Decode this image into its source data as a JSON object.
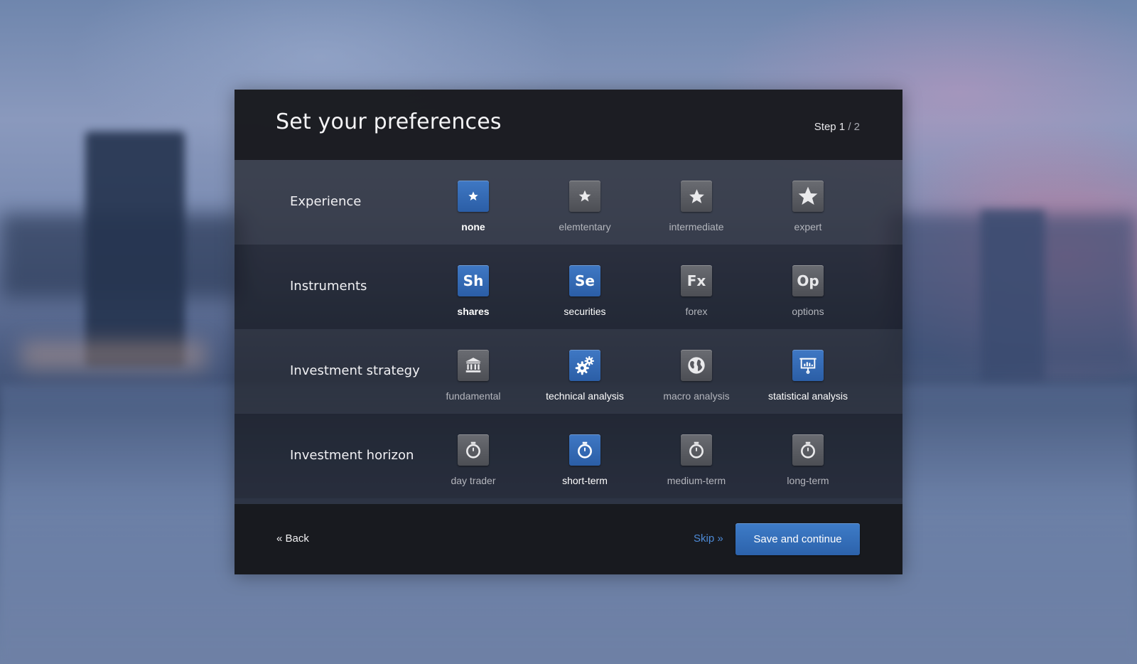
{
  "header": {
    "title": "Set your preferences",
    "step_label": "Step",
    "step_current": "1",
    "step_total": "/ 2"
  },
  "rows": [
    {
      "label": "Experience",
      "options": [
        {
          "label": "none",
          "icon": "star-small-icon",
          "selected": true
        },
        {
          "label": "elemtentary",
          "icon": "star-medium-icon",
          "selected": false
        },
        {
          "label": "intermediate",
          "icon": "star-large-icon",
          "selected": false
        },
        {
          "label": "expert",
          "icon": "star-xlarge-icon",
          "selected": false
        }
      ]
    },
    {
      "label": "Instruments",
      "options": [
        {
          "label": "shares",
          "icon_text": "Sh",
          "selected": true
        },
        {
          "label": "securities",
          "icon_text": "Se",
          "selected": true
        },
        {
          "label": "forex",
          "icon_text": "Fx",
          "selected": false
        },
        {
          "label": "options",
          "icon_text": "Op",
          "selected": false
        }
      ]
    },
    {
      "label": "Investment strategy",
      "options": [
        {
          "label": "fundamental",
          "icon": "bank-icon",
          "selected": false
        },
        {
          "label": "technical analysis",
          "icon": "gears-icon",
          "selected": true
        },
        {
          "label": "macro analysis",
          "icon": "globe-icon",
          "selected": false
        },
        {
          "label": "statistical analysis",
          "icon": "presentation-chart-icon",
          "selected": true
        }
      ]
    },
    {
      "label": "Investment horizon",
      "options": [
        {
          "label": "day trader",
          "icon": "stopwatch-icon",
          "selected": false
        },
        {
          "label": "short-term",
          "icon": "stopwatch-icon",
          "selected": true
        },
        {
          "label": "medium-term",
          "icon": "stopwatch-icon",
          "selected": false
        },
        {
          "label": "long-term",
          "icon": "stopwatch-icon",
          "selected": false
        }
      ]
    }
  ],
  "footer": {
    "back_label": "« Back",
    "skip_label": "Skip »",
    "save_label": "Save and continue"
  },
  "colors": {
    "accent": "#3a72bd",
    "panel": "#1a1b20",
    "skip_link": "#4d8ad6"
  }
}
